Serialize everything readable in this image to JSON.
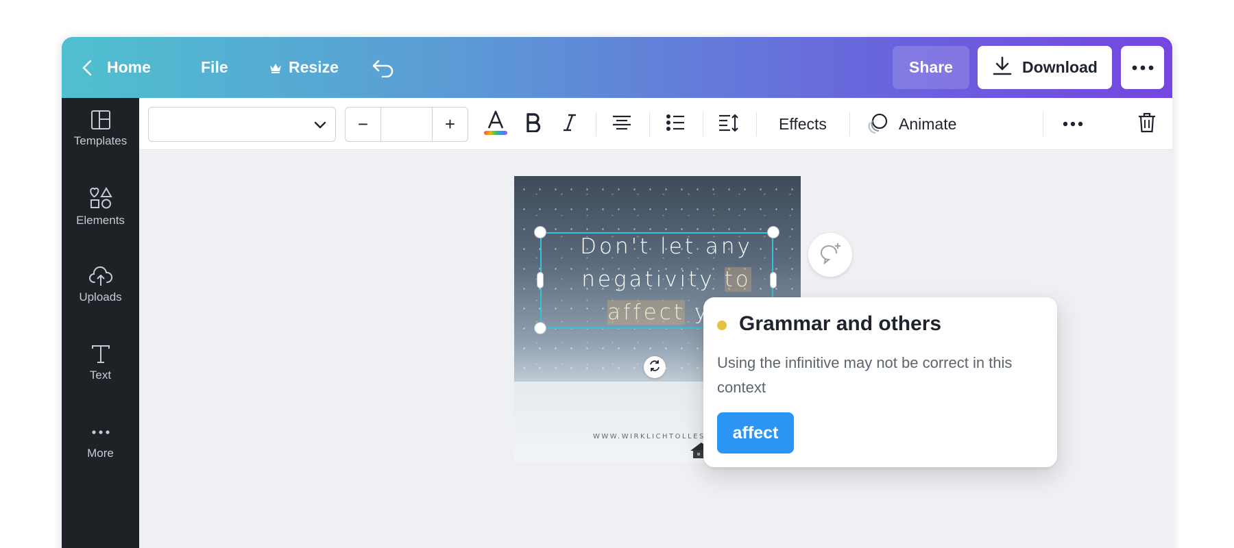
{
  "topbar": {
    "home_label": "Home",
    "file_label": "File",
    "resize_label": "Resize",
    "share_label": "Share",
    "download_label": "Download"
  },
  "sidebar": {
    "items": [
      {
        "label": "Templates",
        "icon": "templates-icon"
      },
      {
        "label": "Elements",
        "icon": "elements-icon"
      },
      {
        "label": "Uploads",
        "icon": "uploads-icon"
      },
      {
        "label": "Text",
        "icon": "text-icon"
      },
      {
        "label": "More",
        "icon": "more-icon"
      }
    ]
  },
  "toolbar": {
    "font_value": "",
    "size_value": "",
    "minus_label": "−",
    "plus_label": "+",
    "effects_label": "Effects",
    "animate_label": "Animate"
  },
  "canvas": {
    "quote_line1": "Don't let any",
    "quote_line2_a": "negativity ",
    "quote_line2_hl": "to",
    "quote_line3_hl": "affect",
    "quote_line3_b": " yo",
    "site_text": "WWW.WIRKLICHTOLLESEITE"
  },
  "grammar_popup": {
    "title": "Grammar and others",
    "description": "Using the infinitive may not be correct in this context",
    "suggestion": "affect",
    "dot_color": "#e3c33f"
  },
  "colors": {
    "accent_blue": "#2b94f5",
    "selection": "#35c1d6",
    "sidebar_bg": "#1e2126"
  }
}
